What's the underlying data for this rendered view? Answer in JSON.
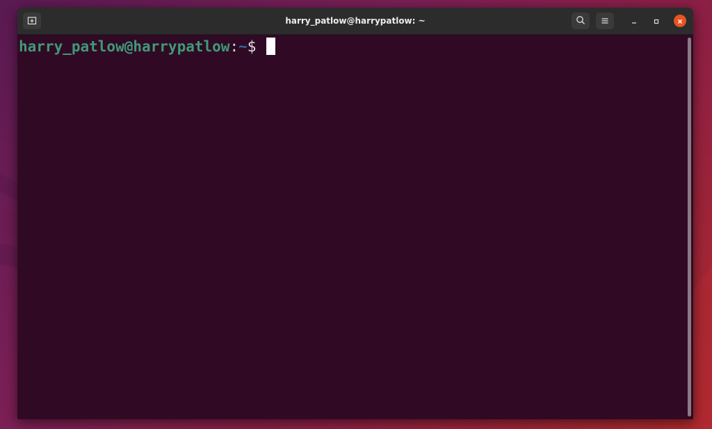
{
  "window": {
    "title": "harry_patlow@harrypatlow: ~"
  },
  "terminal": {
    "prompt_user_host": "harry_patlow@harrypatlow",
    "prompt_colon": ":",
    "prompt_path": "~",
    "prompt_symbol": "$ "
  },
  "colors": {
    "terminal_bg": "#300a24",
    "prompt_user": "#3f9a78",
    "prompt_path": "#3465a4",
    "close_button": "#e95420",
    "titlebar": "#2c2c2c"
  },
  "icons": [
    "new-tab-icon",
    "search-icon",
    "hamburger-menu-icon",
    "minimize-icon",
    "maximize-icon",
    "close-icon"
  ]
}
